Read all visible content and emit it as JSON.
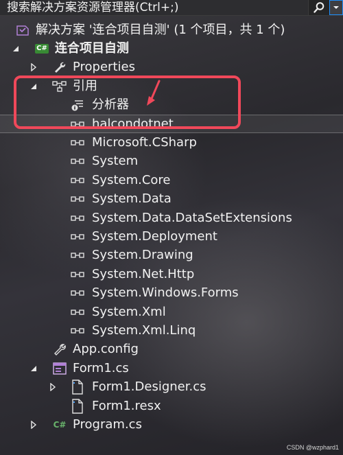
{
  "search": {
    "placeholder": "搜索解决方案资源管理器(Ctrl+;)",
    "search_icon": "search-icon",
    "dropdown_icon": "chevron-down-icon"
  },
  "tree": {
    "solution": {
      "label": "解决方案 '连合项目自测' (1 个项目，共 1 个)",
      "icon": "solution-icon"
    },
    "project": {
      "label": "连合项目自测",
      "icon": "csharp-project-icon",
      "badge": "C#"
    },
    "properties": {
      "label": "Properties",
      "icon": "wrench-icon"
    },
    "references": {
      "label": "引用",
      "icon": "references-icon",
      "analyzers": {
        "label": "分析器",
        "icon": "analyzer-icon"
      },
      "items": [
        "halcondotnet",
        "Microsoft.CSharp",
        "System",
        "System.Core",
        "System.Data",
        "System.Data.DataSetExtensions",
        "System.Deployment",
        "System.Drawing",
        "System.Net.Http",
        "System.Windows.Forms",
        "System.Xml",
        "System.Xml.Linq"
      ]
    },
    "app_config": {
      "label": "App.config",
      "icon": "config-icon"
    },
    "form1": {
      "label": "Form1.cs",
      "icon": "form-icon",
      "children": [
        {
          "label": "Form1.Designer.cs",
          "icon": "file-icon"
        },
        {
          "label": "Form1.resx",
          "icon": "file-icon"
        }
      ]
    },
    "program": {
      "label": "Program.cs",
      "icon": "csharp-file-icon",
      "badge": "C#"
    }
  },
  "watermark": "CSDN @wzphard1",
  "colors": {
    "accent": "#1e90ff",
    "highlight": "#f0485a",
    "csharp_green": "#388a34"
  }
}
